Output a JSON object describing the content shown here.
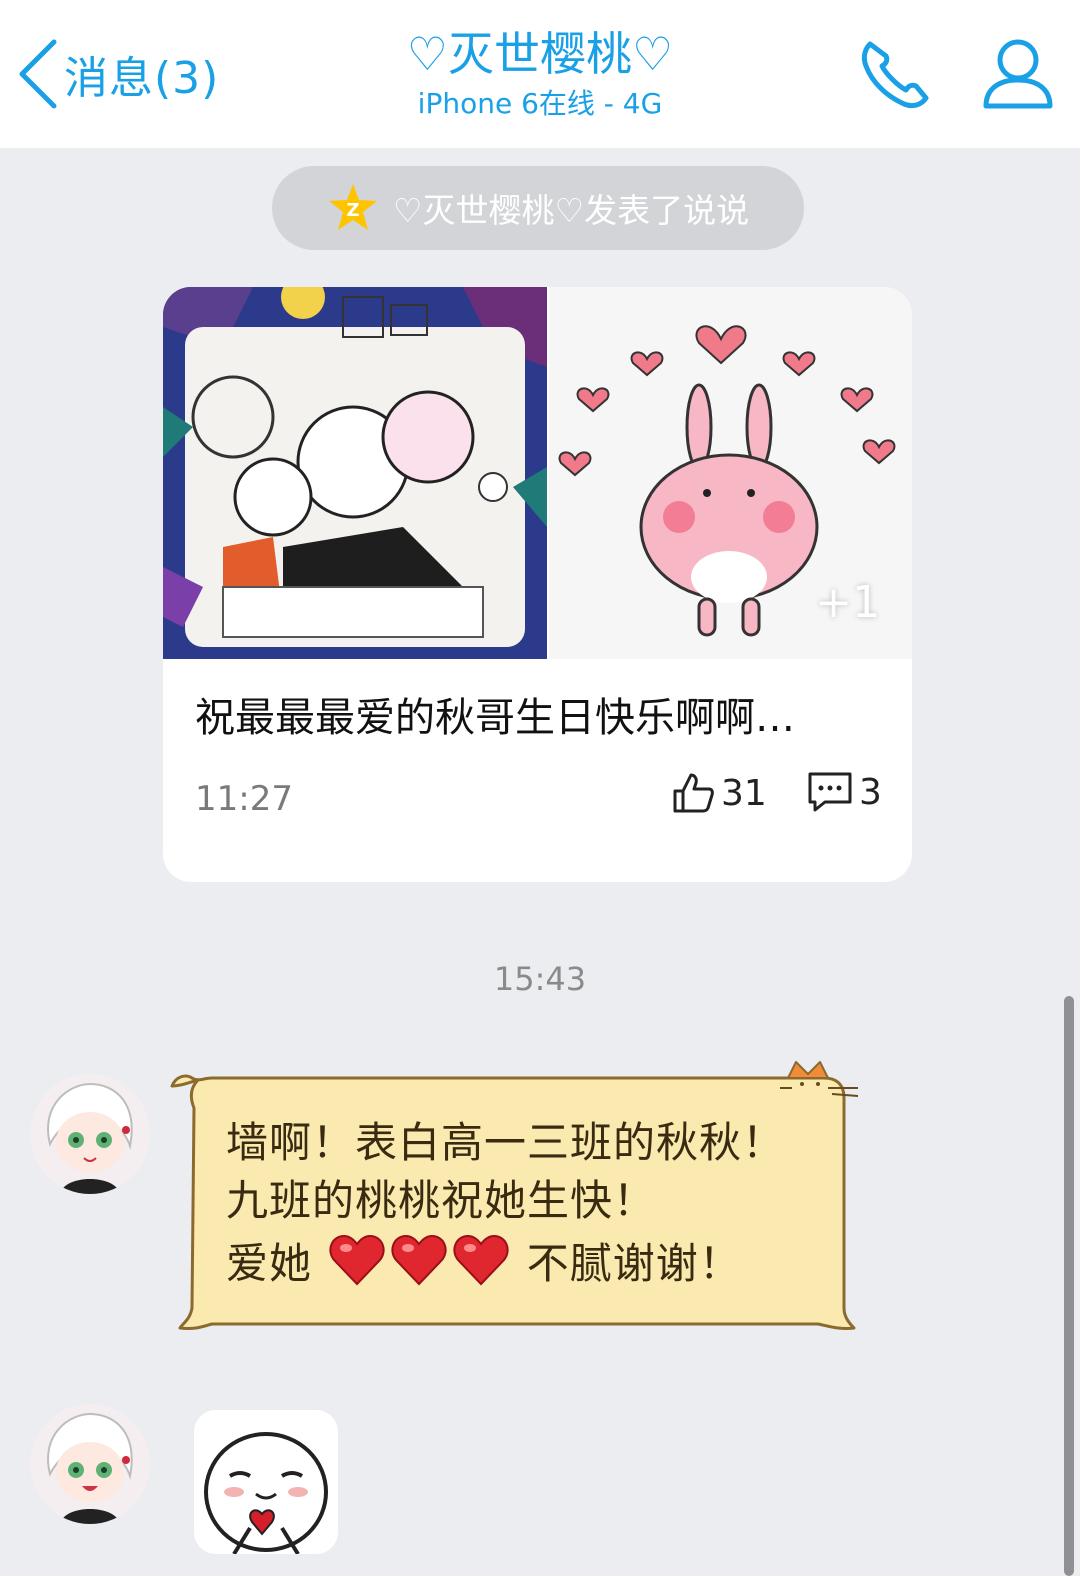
{
  "header": {
    "back_label": "消息(3)",
    "title": "♡灭世樱桃♡",
    "status": "iPhone 6在线 - 4G",
    "icons": [
      "chevron-left-icon",
      "phone-icon",
      "profile-icon"
    ],
    "accent_color": "#1aa0e6"
  },
  "notice": {
    "icon": "qzone-star-icon",
    "text": "♡灭世樱桃♡发表了说说"
  },
  "post_card": {
    "extra_images": "+1",
    "text": "祝最最最爱的秋哥生日快乐啊啊…",
    "time": "11:27",
    "likes": "31",
    "comments": "3"
  },
  "chat": {
    "time_divider": "15:43",
    "message": {
      "line1": "墙啊！表白高一三班的秋秋！九班的桃桃祝她生快！",
      "line2_start": "爱她",
      "line2_end": "不腻谢谢！",
      "hearts": 3,
      "bubble_color": "#faeab0",
      "bubble_border": "#8c6a2e"
    }
  }
}
